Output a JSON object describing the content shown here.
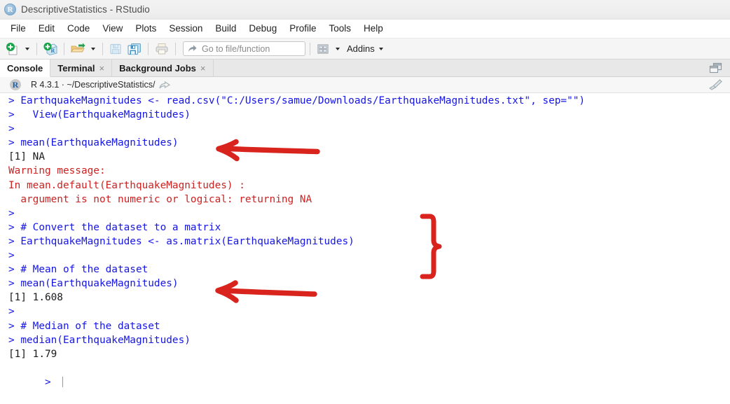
{
  "window": {
    "title": "DescriptiveStatistics - RStudio",
    "logo_letter": "R"
  },
  "menubar": {
    "items": [
      {
        "label": "File"
      },
      {
        "label": "Edit"
      },
      {
        "label": "Code"
      },
      {
        "label": "View"
      },
      {
        "label": "Plots"
      },
      {
        "label": "Session"
      },
      {
        "label": "Build"
      },
      {
        "label": "Debug"
      },
      {
        "label": "Profile"
      },
      {
        "label": "Tools"
      },
      {
        "label": "Help"
      }
    ]
  },
  "toolbar": {
    "new_file_icon": "new-file-icon",
    "new_project_icon": "new-project-icon",
    "open_file_icon": "open-folder-icon",
    "save_icon": "save-icon",
    "save_all_icon": "save-all-icon",
    "print_icon": "print-icon",
    "goto_icon": "goto-arrow-icon",
    "goto_placeholder": "Go to file/function",
    "panes_icon": "workspace-panes-icon",
    "addins_label": "Addins"
  },
  "tabs": {
    "items": [
      {
        "label": "Console",
        "active": true,
        "closable": false
      },
      {
        "label": "Terminal",
        "active": false,
        "closable": true
      },
      {
        "label": "Background Jobs",
        "active": false,
        "closable": true
      }
    ],
    "close_glyph": "×",
    "maximize_icon": "maximize-pane-icon"
  },
  "console_header": {
    "r_badge": "R",
    "version_path": "R 4.3.1 · ~/DescriptiveStatistics/",
    "goto_dir_icon": "open-in-new-window-icon",
    "clear_icon": "broom-clear-console-icon"
  },
  "console": {
    "lines": [
      {
        "type": "cmd",
        "text": "> EarthquakeMagnitudes <- read.csv(\"C:/Users/samue/Downloads/EarthquakeMagnitudes.txt\", sep=\"\")"
      },
      {
        "type": "cmd",
        "text": ">   View(EarthquakeMagnitudes)"
      },
      {
        "type": "cmd",
        "text": "> "
      },
      {
        "type": "cmd",
        "text": "> mean(EarthquakeMagnitudes)"
      },
      {
        "type": "out",
        "text": "[1] NA"
      },
      {
        "type": "err",
        "text": "Warning message:"
      },
      {
        "type": "err",
        "text": "In mean.default(EarthquakeMagnitudes) :"
      },
      {
        "type": "err",
        "text": "  argument is not numeric or logical: returning NA"
      },
      {
        "type": "cmd",
        "text": "> "
      },
      {
        "type": "cmd",
        "text": "> # Convert the dataset to a matrix"
      },
      {
        "type": "cmd",
        "text": "> EarthquakeMagnitudes <- as.matrix(EarthquakeMagnitudes)"
      },
      {
        "type": "cmd",
        "text": "> "
      },
      {
        "type": "cmd",
        "text": "> # Mean of the dataset"
      },
      {
        "type": "cmd",
        "text": "> mean(EarthquakeMagnitudes)"
      },
      {
        "type": "out",
        "text": "[1] 1.608"
      },
      {
        "type": "cmd",
        "text": "> "
      },
      {
        "type": "cmd",
        "text": "> # Median of the dataset"
      },
      {
        "type": "cmd",
        "text": "> median(EarthquakeMagnitudes)"
      },
      {
        "type": "out",
        "text": "[1] 1.79"
      },
      {
        "type": "cmd",
        "text": "> ",
        "cursor": true
      }
    ]
  },
  "annotations": {
    "color": "#d9231d",
    "items": [
      {
        "name": "arrow-to-mean-call",
        "kind": "left-arrow"
      },
      {
        "name": "brace-around-matrix-conversion",
        "kind": "right-brace"
      },
      {
        "name": "arrow-to-mean-result",
        "kind": "left-arrow"
      }
    ]
  },
  "colors": {
    "command_blue": "#1515e8",
    "error_red": "#cc2222",
    "output_black": "#1a1a1a",
    "annotation_red": "#d9231d",
    "tabbar_gray": "#e8e8e8"
  }
}
